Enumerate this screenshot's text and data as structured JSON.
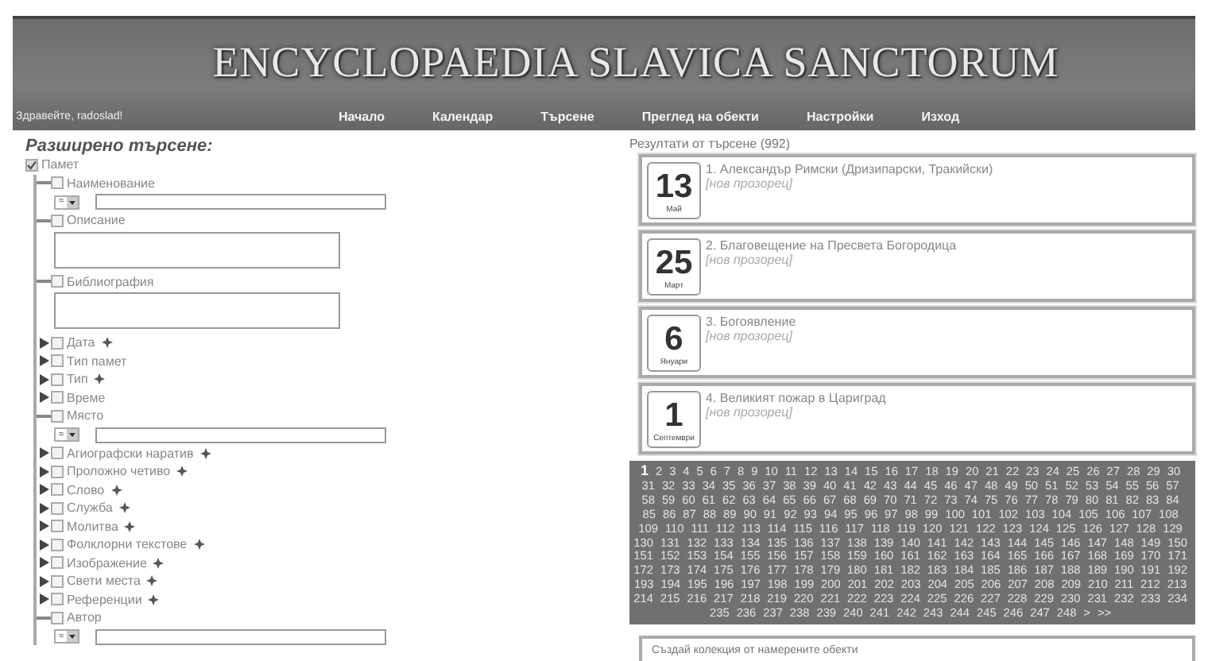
{
  "header": {
    "title": "ENCYCLOPAEDIA SLAVICA SANCTORUM",
    "greeting": "Здравейте, radoslad!",
    "nav": [
      {
        "label": "Начало"
      },
      {
        "label": "Календар"
      },
      {
        "label": "Търсене"
      },
      {
        "label": "Преглед на обекти"
      },
      {
        "label": "Настройки"
      },
      {
        "label": "Изход"
      }
    ]
  },
  "search": {
    "heading": "Разширено търсене:",
    "tree": {
      "label": "Памет",
      "checked": true,
      "children": [
        {
          "label": "Наименование",
          "checked": false,
          "expanded": true,
          "addable": false,
          "field": {
            "kind": "match",
            "operator": "≈"
          }
        },
        {
          "label": "Описание",
          "checked": false,
          "expanded": true,
          "addable": false,
          "field": {
            "kind": "textarea"
          }
        },
        {
          "label": "Библиография",
          "checked": false,
          "expanded": true,
          "addable": false,
          "field": {
            "kind": "textarea"
          }
        },
        {
          "label": "Дата",
          "checked": false,
          "expanded": false,
          "addable": true
        },
        {
          "label": "Тип памет",
          "checked": false,
          "expanded": false,
          "addable": false
        },
        {
          "label": "Тип",
          "checked": false,
          "expanded": false,
          "addable": true
        },
        {
          "label": "Време",
          "checked": false,
          "expanded": false,
          "addable": false
        },
        {
          "label": "Място",
          "checked": false,
          "expanded": true,
          "addable": false,
          "field": {
            "kind": "match",
            "operator": "≈"
          }
        },
        {
          "label": "Агиографски наратив",
          "checked": false,
          "expanded": false,
          "addable": true
        },
        {
          "label": "Проложно четиво",
          "checked": false,
          "expanded": false,
          "addable": true
        },
        {
          "label": "Слово",
          "checked": false,
          "expanded": false,
          "addable": true
        },
        {
          "label": "Служба",
          "checked": false,
          "expanded": false,
          "addable": true
        },
        {
          "label": "Молитва",
          "checked": false,
          "expanded": false,
          "addable": true
        },
        {
          "label": "Фолклорни текстове",
          "checked": false,
          "expanded": false,
          "addable": true
        },
        {
          "label": "Изображение",
          "checked": false,
          "expanded": false,
          "addable": true
        },
        {
          "label": "Свети места",
          "checked": false,
          "expanded": false,
          "addable": true
        },
        {
          "label": "Референции",
          "checked": false,
          "expanded": false,
          "addable": true
        },
        {
          "label": "Автор",
          "checked": false,
          "expanded": true,
          "addable": false,
          "field": {
            "kind": "match",
            "operator": "≈"
          }
        }
      ]
    }
  },
  "results": {
    "heading": "Резултати от търсене (992)",
    "items": [
      {
        "day": "13",
        "month": "Май",
        "title": "1. Александър Римски (Дризипарски, Тракийски)",
        "link": "[нов прозорец]"
      },
      {
        "day": "25",
        "month": "Март",
        "title": "2. Благовещение на Пресвета Богородица",
        "link": "[нов прозорец]"
      },
      {
        "day": "6",
        "month": "Януари",
        "title": "3. Богоявление",
        "link": "[нов прозорец]"
      },
      {
        "day": "1",
        "month": "Септември",
        "title": "4. Великият пожар в Цариград",
        "link": "[нов прозорец]"
      }
    ],
    "pages": [
      {
        "label": "1",
        "selected": true
      },
      {
        "label": "2",
        "selected": false
      },
      {
        "label": "3",
        "selected": false
      },
      {
        "label": "4",
        "selected": false
      },
      {
        "label": "5",
        "selected": false
      },
      {
        "label": "6",
        "selected": false
      },
      {
        "label": "7",
        "selected": false
      },
      {
        "label": "8",
        "selected": false
      },
      {
        "label": "9",
        "selected": false
      },
      {
        "label": "10",
        "selected": false
      },
      {
        "label": "11",
        "selected": false
      },
      {
        "label": "12",
        "selected": false
      },
      {
        "label": "13",
        "selected": false
      },
      {
        "label": "14",
        "selected": false
      },
      {
        "label": "15",
        "selected": false
      },
      {
        "label": "16",
        "selected": false
      },
      {
        "label": "17",
        "selected": false
      },
      {
        "label": "18",
        "selected": false
      },
      {
        "label": "19",
        "selected": false
      },
      {
        "label": "20",
        "selected": false
      },
      {
        "label": "21",
        "selected": false
      },
      {
        "label": "22",
        "selected": false
      },
      {
        "label": "23",
        "selected": false
      },
      {
        "label": "24",
        "selected": false
      },
      {
        "label": "25",
        "selected": false
      },
      {
        "label": "26",
        "selected": false
      },
      {
        "label": "27",
        "selected": false
      },
      {
        "label": "28",
        "selected": false
      },
      {
        "label": "29",
        "selected": false
      },
      {
        "label": "30",
        "selected": false
      },
      {
        "label": "31",
        "selected": false
      },
      {
        "label": "32",
        "selected": false
      },
      {
        "label": "33",
        "selected": false
      },
      {
        "label": "34",
        "selected": false
      },
      {
        "label": "35",
        "selected": false
      },
      {
        "label": "36",
        "selected": false
      },
      {
        "label": "37",
        "selected": false
      },
      {
        "label": "38",
        "selected": false
      },
      {
        "label": "39",
        "selected": false
      },
      {
        "label": "40",
        "selected": false
      },
      {
        "label": "41",
        "selected": false
      },
      {
        "label": "42",
        "selected": false
      },
      {
        "label": "43",
        "selected": false
      },
      {
        "label": "44",
        "selected": false
      },
      {
        "label": "45",
        "selected": false
      },
      {
        "label": "46",
        "selected": false
      },
      {
        "label": "47",
        "selected": false
      },
      {
        "label": "48",
        "selected": false
      },
      {
        "label": "49",
        "selected": false
      },
      {
        "label": "50",
        "selected": false
      },
      {
        "label": "51",
        "selected": false
      },
      {
        "label": "52",
        "selected": false
      },
      {
        "label": "53",
        "selected": false
      },
      {
        "label": "54",
        "selected": false
      },
      {
        "label": "55",
        "selected": false
      },
      {
        "label": "56",
        "selected": false
      },
      {
        "label": "57",
        "selected": false
      },
      {
        "label": "58",
        "selected": false
      },
      {
        "label": "59",
        "selected": false
      },
      {
        "label": "60",
        "selected": false
      },
      {
        "label": "61",
        "selected": false
      },
      {
        "label": "62",
        "selected": false
      },
      {
        "label": "63",
        "selected": false
      },
      {
        "label": "64",
        "selected": false
      },
      {
        "label": "65",
        "selected": false
      },
      {
        "label": "66",
        "selected": false
      },
      {
        "label": "67",
        "selected": false
      },
      {
        "label": "68",
        "selected": false
      },
      {
        "label": "69",
        "selected": false
      },
      {
        "label": "70",
        "selected": false
      },
      {
        "label": "71",
        "selected": false
      },
      {
        "label": "72",
        "selected": false
      },
      {
        "label": "73",
        "selected": false
      },
      {
        "label": "74",
        "selected": false
      },
      {
        "label": "75",
        "selected": false
      },
      {
        "label": "76",
        "selected": false
      },
      {
        "label": "77",
        "selected": false
      },
      {
        "label": "78",
        "selected": false
      },
      {
        "label": "79",
        "selected": false
      },
      {
        "label": "80",
        "selected": false
      },
      {
        "label": "81",
        "selected": false
      },
      {
        "label": "82",
        "selected": false
      },
      {
        "label": "83",
        "selected": false
      },
      {
        "label": "84",
        "selected": false
      },
      {
        "label": "85",
        "selected": false
      },
      {
        "label": "86",
        "selected": false
      },
      {
        "label": "87",
        "selected": false
      },
      {
        "label": "88",
        "selected": false
      },
      {
        "label": "89",
        "selected": false
      },
      {
        "label": "90",
        "selected": false
      },
      {
        "label": "91",
        "selected": false
      },
      {
        "label": "92",
        "selected": false
      },
      {
        "label": "93",
        "selected": false
      },
      {
        "label": "94",
        "selected": false
      },
      {
        "label": "95",
        "selected": false
      },
      {
        "label": "96",
        "selected": false
      },
      {
        "label": "97",
        "selected": false
      },
      {
        "label": "98",
        "selected": false
      },
      {
        "label": "99",
        "selected": false
      },
      {
        "label": "100",
        "selected": false
      },
      {
        "label": "101",
        "selected": false
      },
      {
        "label": "102",
        "selected": false
      },
      {
        "label": "103",
        "selected": false
      },
      {
        "label": "104",
        "selected": false
      },
      {
        "label": "105",
        "selected": false
      },
      {
        "label": "106",
        "selected": false
      },
      {
        "label": "107",
        "selected": false
      },
      {
        "label": "108",
        "selected": false
      },
      {
        "label": "109",
        "selected": false
      },
      {
        "label": "110",
        "selected": false
      },
      {
        "label": "111",
        "selected": false
      },
      {
        "label": "112",
        "selected": false
      },
      {
        "label": "113",
        "selected": false
      },
      {
        "label": "114",
        "selected": false
      },
      {
        "label": "115",
        "selected": false
      },
      {
        "label": "116",
        "selected": false
      },
      {
        "label": "117",
        "selected": false
      },
      {
        "label": "118",
        "selected": false
      },
      {
        "label": "119",
        "selected": false
      },
      {
        "label": "120",
        "selected": false
      },
      {
        "label": "121",
        "selected": false
      },
      {
        "label": "122",
        "selected": false
      },
      {
        "label": "123",
        "selected": false
      },
      {
        "label": "124",
        "selected": false
      },
      {
        "label": "125",
        "selected": false
      },
      {
        "label": "126",
        "selected": false
      },
      {
        "label": "127",
        "selected": false
      },
      {
        "label": "128",
        "selected": false
      },
      {
        "label": "129",
        "selected": false
      },
      {
        "label": "130",
        "selected": false
      },
      {
        "label": "131",
        "selected": false
      },
      {
        "label": "132",
        "selected": false
      },
      {
        "label": "133",
        "selected": false
      },
      {
        "label": "134",
        "selected": false
      },
      {
        "label": "135",
        "selected": false
      },
      {
        "label": "136",
        "selected": false
      },
      {
        "label": "137",
        "selected": false
      },
      {
        "label": "138",
        "selected": false
      },
      {
        "label": "139",
        "selected": false
      },
      {
        "label": "140",
        "selected": false
      },
      {
        "label": "141",
        "selected": false
      },
      {
        "label": "142",
        "selected": false
      },
      {
        "label": "143",
        "selected": false
      },
      {
        "label": "144",
        "selected": false
      },
      {
        "label": "145",
        "selected": false
      },
      {
        "label": "146",
        "selected": false
      },
      {
        "label": "147",
        "selected": false
      },
      {
        "label": "148",
        "selected": false
      },
      {
        "label": "149",
        "selected": false
      },
      {
        "label": "150",
        "selected": false
      },
      {
        "label": "151",
        "selected": false
      },
      {
        "label": "152",
        "selected": false
      },
      {
        "label": "153",
        "selected": false
      },
      {
        "label": "154",
        "selected": false
      },
      {
        "label": "155",
        "selected": false
      },
      {
        "label": "156",
        "selected": false
      },
      {
        "label": "157",
        "selected": false
      },
      {
        "label": "158",
        "selected": false
      },
      {
        "label": "159",
        "selected": false
      },
      {
        "label": "160",
        "selected": false
      },
      {
        "label": "161",
        "selected": false
      },
      {
        "label": "162",
        "selected": false
      },
      {
        "label": "163",
        "selected": false
      },
      {
        "label": "164",
        "selected": false
      },
      {
        "label": "165",
        "selected": false
      },
      {
        "label": "166",
        "selected": false
      },
      {
        "label": "167",
        "selected": false
      },
      {
        "label": "168",
        "selected": false
      },
      {
        "label": "169",
        "selected": false
      },
      {
        "label": "170",
        "selected": false
      },
      {
        "label": "171",
        "selected": false
      },
      {
        "label": "172",
        "selected": false
      },
      {
        "label": "173",
        "selected": false
      },
      {
        "label": "174",
        "selected": false
      },
      {
        "label": "175",
        "selected": false
      },
      {
        "label": "176",
        "selected": false
      },
      {
        "label": "177",
        "selected": false
      },
      {
        "label": "178",
        "selected": false
      },
      {
        "label": "179",
        "selected": false
      },
      {
        "label": "180",
        "selected": false
      },
      {
        "label": "181",
        "selected": false
      },
      {
        "label": "182",
        "selected": false
      },
      {
        "label": "183",
        "selected": false
      },
      {
        "label": "184",
        "selected": false
      },
      {
        "label": "185",
        "selected": false
      },
      {
        "label": "186",
        "selected": false
      },
      {
        "label": "187",
        "selected": false
      },
      {
        "label": "188",
        "selected": false
      },
      {
        "label": "189",
        "selected": false
      },
      {
        "label": "190",
        "selected": false
      },
      {
        "label": "191",
        "selected": false
      },
      {
        "label": "192",
        "selected": false
      },
      {
        "label": "193",
        "selected": false
      },
      {
        "label": "194",
        "selected": false
      },
      {
        "label": "195",
        "selected": false
      },
      {
        "label": "196",
        "selected": false
      },
      {
        "label": "197",
        "selected": false
      },
      {
        "label": "198",
        "selected": false
      },
      {
        "label": "199",
        "selected": false
      },
      {
        "label": "200",
        "selected": false
      },
      {
        "label": "201",
        "selected": false
      },
      {
        "label": "202",
        "selected": false
      },
      {
        "label": "203",
        "selected": false
      },
      {
        "label": "204",
        "selected": false
      },
      {
        "label": "205",
        "selected": false
      },
      {
        "label": "206",
        "selected": false
      },
      {
        "label": "207",
        "selected": false
      },
      {
        "label": "208",
        "selected": false
      },
      {
        "label": "209",
        "selected": false
      },
      {
        "label": "210",
        "selected": false
      },
      {
        "label": "211",
        "selected": false
      },
      {
        "label": "212",
        "selected": false
      },
      {
        "label": "213",
        "selected": false
      },
      {
        "label": "214",
        "selected": false
      },
      {
        "label": "215",
        "selected": false
      },
      {
        "label": "216",
        "selected": false
      },
      {
        "label": "217",
        "selected": false
      },
      {
        "label": "218",
        "selected": false
      },
      {
        "label": "219",
        "selected": false
      },
      {
        "label": "220",
        "selected": false
      },
      {
        "label": "221",
        "selected": false
      },
      {
        "label": "222",
        "selected": false
      },
      {
        "label": "223",
        "selected": false
      },
      {
        "label": "224",
        "selected": false
      },
      {
        "label": "225",
        "selected": false
      },
      {
        "label": "226",
        "selected": false
      },
      {
        "label": "227",
        "selected": false
      },
      {
        "label": "228",
        "selected": false
      },
      {
        "label": "229",
        "selected": false
      },
      {
        "label": "230",
        "selected": false
      },
      {
        "label": "231",
        "selected": false
      },
      {
        "label": "232",
        "selected": false
      },
      {
        "label": "233",
        "selected": false
      },
      {
        "label": "234",
        "selected": false
      },
      {
        "label": "235",
        "selected": false
      },
      {
        "label": "236",
        "selected": false
      },
      {
        "label": "237",
        "selected": false
      },
      {
        "label": "238",
        "selected": false
      },
      {
        "label": "239",
        "selected": false
      },
      {
        "label": "240",
        "selected": false
      },
      {
        "label": "241",
        "selected": false
      },
      {
        "label": "242",
        "selected": false
      },
      {
        "label": "243",
        "selected": false
      },
      {
        "label": "244",
        "selected": false
      },
      {
        "label": "245",
        "selected": false
      },
      {
        "label": "246",
        "selected": false
      },
      {
        "label": "247",
        "selected": false
      },
      {
        "label": "248",
        "selected": false
      },
      {
        "label": ">",
        "selected": false
      },
      {
        "label": ">>",
        "selected": false
      }
    ],
    "collection": "Създай колекция от намерените обекти"
  }
}
